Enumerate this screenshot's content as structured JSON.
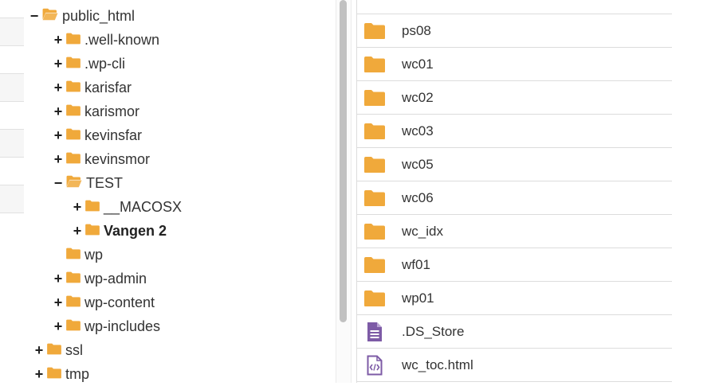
{
  "tree": {
    "nodes": [
      {
        "label": "public_html",
        "toggle": "−",
        "open": true,
        "bold": false
      },
      {
        "label": ".well-known",
        "toggle": "+",
        "open": false,
        "bold": false
      },
      {
        "label": ".wp-cli",
        "toggle": "+",
        "open": false,
        "bold": false
      },
      {
        "label": "karisfar",
        "toggle": "+",
        "open": false,
        "bold": false
      },
      {
        "label": "karismor",
        "toggle": "+",
        "open": false,
        "bold": false
      },
      {
        "label": "kevinsfar",
        "toggle": "+",
        "open": false,
        "bold": false
      },
      {
        "label": "kevinsmor",
        "toggle": "+",
        "open": false,
        "bold": false
      },
      {
        "label": "TEST",
        "toggle": "−",
        "open": true,
        "bold": false
      },
      {
        "label": "__MACOSX",
        "toggle": "+",
        "open": false,
        "bold": false
      },
      {
        "label": "Vangen 2",
        "toggle": "+",
        "open": false,
        "bold": true
      },
      {
        "label": "wp",
        "toggle": "",
        "open": false,
        "bold": false
      },
      {
        "label": "wp-admin",
        "toggle": "+",
        "open": false,
        "bold": false
      },
      {
        "label": "wp-content",
        "toggle": "+",
        "open": false,
        "bold": false
      },
      {
        "label": "wp-includes",
        "toggle": "+",
        "open": false,
        "bold": false
      },
      {
        "label": "ssl",
        "toggle": "+",
        "open": false,
        "bold": false
      },
      {
        "label": "tmp",
        "toggle": "+",
        "open": false,
        "bold": false
      }
    ]
  },
  "files": [
    {
      "name": "ps08",
      "icon": "folder-icon"
    },
    {
      "name": "wc01",
      "icon": "folder-icon"
    },
    {
      "name": "wc02",
      "icon": "folder-icon"
    },
    {
      "name": "wc03",
      "icon": "folder-icon"
    },
    {
      "name": "wc05",
      "icon": "folder-icon"
    },
    {
      "name": "wc06",
      "icon": "folder-icon"
    },
    {
      "name": "wc_idx",
      "icon": "folder-icon"
    },
    {
      "name": "wf01",
      "icon": "folder-icon"
    },
    {
      "name": "wp01",
      "icon": "folder-icon"
    },
    {
      "name": ".DS_Store",
      "icon": "text-file-icon"
    },
    {
      "name": "wc_toc.html",
      "icon": "html-file-icon"
    }
  ],
  "colors": {
    "folder": "#f0a93b",
    "file": "#7d5ba6"
  }
}
